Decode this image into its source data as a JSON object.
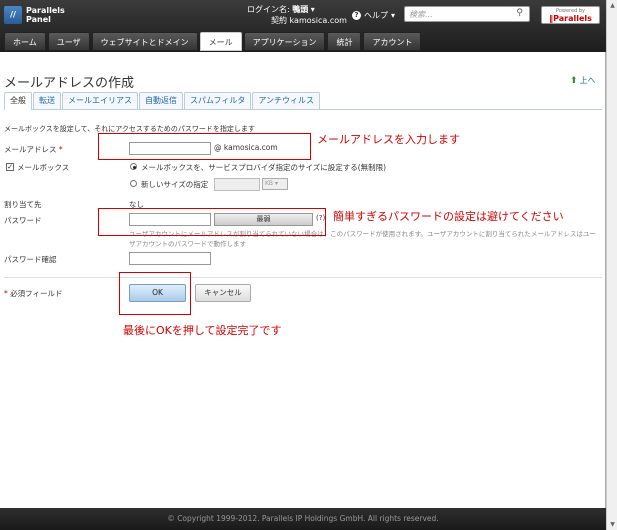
{
  "header": {
    "logo_line1": "Parallels",
    "logo_line2": "Panel",
    "login_label": "ログイン名:",
    "login_name": "鴨頭",
    "contract_label": "契約",
    "contract_domain": "kamosica.com",
    "help_label": "ヘルプ",
    "search_placeholder": "検索...",
    "powered_by": "Powered by",
    "powered_brand": "Parallels"
  },
  "nav": {
    "tabs": [
      "ホーム",
      "ユーザ",
      "ウェブサイトとドメイン",
      "メール",
      "アプリケーション",
      "統計",
      "アカウント"
    ]
  },
  "page": {
    "title": "メールアドレスの作成",
    "up_label": "上へ",
    "tabs": [
      "全般",
      "転送",
      "メールエイリアス",
      "自動返信",
      "スパムフィルタ",
      "アンチウィルス"
    ],
    "description": "メールボックスを設定して、それにアクセスするためのパスワードを指定します"
  },
  "form": {
    "email_label": "メールアドレス",
    "email_value": "",
    "required_mark": "*",
    "domain": "@ kamosica.com",
    "mailbox_label": "メールボックス",
    "mailbox_checked": "✓",
    "radio_default": "メールボックスを、サービスプロバイダ指定のサイズに設定する(無制限)",
    "radio_custom": "新しいサイズの指定",
    "size_unit": "KB",
    "assigned_label": "割り当て先",
    "assigned_value": "なし",
    "password_label": "パスワード",
    "password_value": "",
    "strength": "最弱",
    "help_q": "(?)",
    "password_note": "ユーザアカウントにメールアドレスが割り当てられていない場合は、このパスワードが使用されます。ユーザアカウントに割り当てられたメールアドレスはユーザアカウントのパスワードで動作します",
    "confirm_label": "パスワード確認",
    "confirm_value": "",
    "required_field": "必須フィールド",
    "ok": "OK",
    "cancel": "キャンセル"
  },
  "annotations": {
    "a1": "メールアドレスを入力します",
    "a2": "簡単すぎるパスワードの設定は避けてください",
    "a3": "最後にOKを押して設定完了です"
  },
  "footer": {
    "copyright": "© Copyright 1999-2012. Parallels IP Holdings GmbH. All rights reserved."
  },
  "colors": {
    "annotation": "#d40000",
    "link": "#2266aa",
    "header_bg": "#2a2a2a"
  }
}
